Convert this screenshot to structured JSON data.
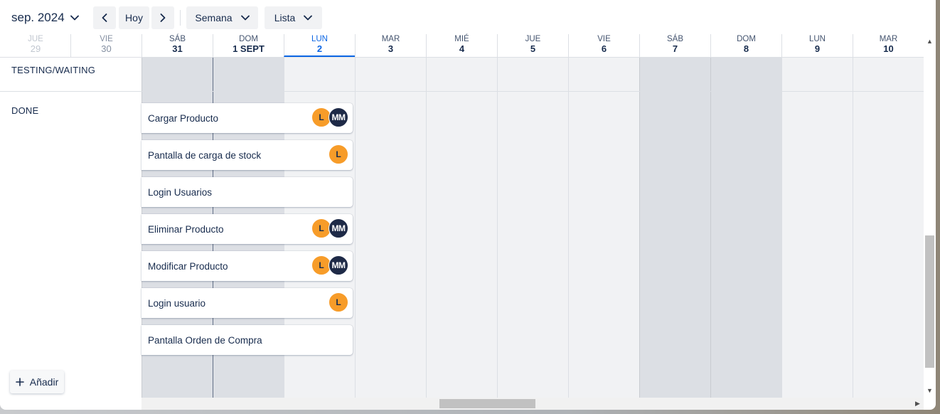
{
  "toolbar": {
    "month_label": "sep. 2024",
    "today_label": "Hoy",
    "view_label": "Semana",
    "list_label": "Lista"
  },
  "days": [
    {
      "name": "JUE",
      "num": "29"
    },
    {
      "name": "VIE",
      "num": "30"
    },
    {
      "name": "SÁB",
      "num": "31"
    },
    {
      "name": "DOM",
      "num": "1 SEPT"
    },
    {
      "name": "LUN",
      "num": "2"
    },
    {
      "name": "MAR",
      "num": "3"
    },
    {
      "name": "MIÉ",
      "num": "4"
    },
    {
      "name": "JUE",
      "num": "5"
    },
    {
      "name": "VIE",
      "num": "6"
    },
    {
      "name": "SÁB",
      "num": "7"
    },
    {
      "name": "DOM",
      "num": "8"
    },
    {
      "name": "LUN",
      "num": "9"
    },
    {
      "name": "MAR",
      "num": "10"
    }
  ],
  "groups": {
    "testing": "TESTING/WAITING",
    "done": "DONE"
  },
  "cards": [
    {
      "title": "Cargar Producto",
      "avatars": [
        "L",
        "MM"
      ]
    },
    {
      "title": "Pantalla de carga de stock",
      "avatars": [
        "L"
      ]
    },
    {
      "title": "Login Usuarios",
      "avatars": []
    },
    {
      "title": "Eliminar Producto",
      "avatars": [
        "L",
        "MM"
      ]
    },
    {
      "title": "Modificar Producto",
      "avatars": [
        "L",
        "MM"
      ]
    },
    {
      "title": "Login usuario",
      "avatars": [
        "L"
      ]
    },
    {
      "title": "Pantalla Orden de Compra",
      "avatars": []
    }
  ],
  "add_label": "Añadir",
  "colors": {
    "today": "#0c66e4",
    "avatar_orange": "#f79c29",
    "avatar_navy": "#1e2a47"
  },
  "icons": {
    "month_dropdown": "chevron-down-icon",
    "prev": "chevron-left-icon",
    "next": "chevron-right-icon",
    "add": "plus-icon"
  }
}
